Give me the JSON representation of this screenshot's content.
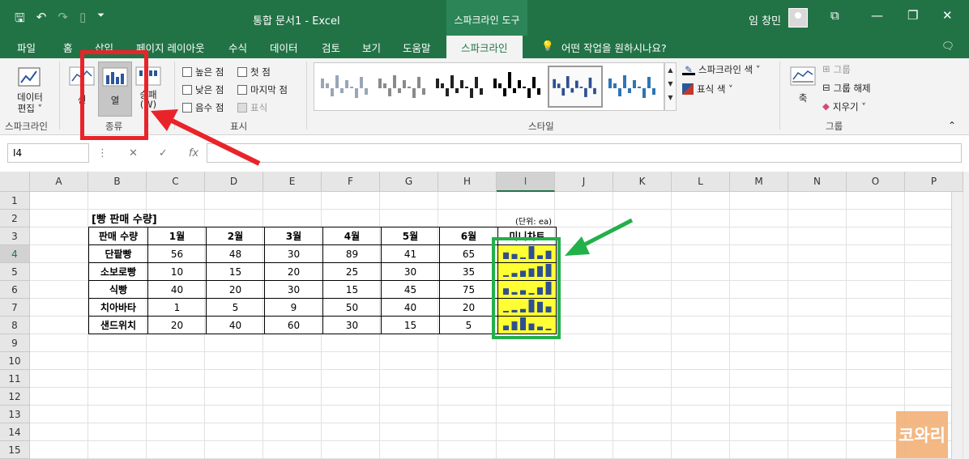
{
  "titlebar": {
    "doc_title": "통합 문서1  -  Excel",
    "context_tool": "스파크라인 도구",
    "user_name": "임 창민",
    "minimize": "—",
    "restore": "❐",
    "close": "✕",
    "ribbon_display": "⧉"
  },
  "tabs": [
    "파일",
    "홈",
    "삽입",
    "페이지 레이아웃",
    "수식",
    "데이터",
    "검토",
    "보기",
    "도움말",
    "스파크라인"
  ],
  "tell_me": "어떤 작업을 원하시나요?",
  "ribbon": {
    "edit_data_label": "데이터\n편집 ˅",
    "group_sparkline": "스파크라인",
    "type_line": "선",
    "type_column": "열",
    "type_winloss": "승패\n(W)",
    "group_type": "종류",
    "show_checks": {
      "high": "높은 점",
      "low": "낮은 점",
      "negative": "음수 점",
      "first": "첫 점",
      "last": "마지막 점",
      "markers": "표식"
    },
    "group_show": "표시",
    "group_style": "스타일",
    "sparkline_color": "스파크라인 색 ˅",
    "marker_color": "표식 색 ˅",
    "axis": "축",
    "group_btn": "그룹",
    "ungroup_btn": "그룹 해제",
    "clear_btn": "지우기 ˅",
    "group_group": "그룹"
  },
  "formula_bar": {
    "name_box": "I4",
    "fx": "fx",
    "cancel": "✕",
    "enter": "✓"
  },
  "columns": [
    "A",
    "B",
    "C",
    "D",
    "E",
    "F",
    "G",
    "H",
    "I",
    "J",
    "K",
    "L",
    "M",
    "N",
    "O",
    "P"
  ],
  "rows": [
    "1",
    "2",
    "3",
    "4",
    "5",
    "6",
    "7",
    "8",
    "9",
    "10",
    "11",
    "12",
    "13",
    "14",
    "15"
  ],
  "sheet": {
    "title": "[빵 판매 수량]",
    "unit": "(단위: ea)",
    "headers": [
      "판매 수량",
      "1월",
      "2월",
      "3월",
      "4월",
      "5월",
      "6월",
      "미니차트"
    ],
    "items": [
      {
        "name": "단팥빵",
        "values": [
          56,
          48,
          30,
          89,
          41,
          65
        ]
      },
      {
        "name": "소보로빵",
        "values": [
          10,
          15,
          20,
          25,
          30,
          35
        ]
      },
      {
        "name": "식빵",
        "values": [
          40,
          20,
          30,
          15,
          45,
          75
        ]
      },
      {
        "name": "치아바타",
        "values": [
          1,
          5,
          9,
          50,
          40,
          20
        ]
      },
      {
        "name": "샌드위치",
        "values": [
          20,
          40,
          60,
          30,
          15,
          5
        ]
      }
    ]
  },
  "colors": {
    "excel_green": "#217346",
    "sparkline_fill": "#ffff33",
    "sparkline_bar": "#2f4f8f",
    "highlight_red": "#e8242a",
    "highlight_green": "#22b04a"
  },
  "watermark": "코와리"
}
